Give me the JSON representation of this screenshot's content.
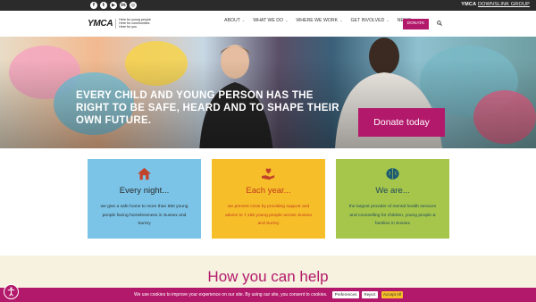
{
  "topbar": {
    "social": [
      "f",
      "t",
      "▶",
      "in",
      "◎"
    ],
    "group_link_bold": "YMCA",
    "group_link_rest": "DOWNSLINK GROUP"
  },
  "header": {
    "logo_word": "YMCA",
    "logo_tag": [
      "Here for young people",
      "Here for communities",
      "Here for you"
    ],
    "nav": [
      "ABOUT",
      "WHAT WE DO",
      "WHERE WE WORK",
      "GET INVOLVED",
      "NEWS"
    ],
    "donate": "DONATE"
  },
  "hero": {
    "headline": "EVERY CHILD AND YOUNG PERSON HAS THE RIGHT TO BE SAFE, HEARD AND TO SHAPE THEIR OWN FUTURE.",
    "button": "Donate today"
  },
  "cards": [
    {
      "title": "Every night...",
      "body": "we give a safe home to more than 650 young people facing homelessness in Sussex and Surrey",
      "icon": "house-icon",
      "color": "#7bc4e8"
    },
    {
      "title": "Each year...",
      "body": "we prevent crisis by providing support and advice to 7,156 young people across Sussex and Surrey",
      "icon": "hand-heart-icon",
      "color": "#f6bf2a"
    },
    {
      "title": "We are...",
      "body": "the largest provider of mental health services and counselling for children, young people & families in Sussex",
      "icon": "brain-icon",
      "color": "#a5c64b"
    }
  ],
  "help": {
    "title": "How you can help"
  },
  "cookie": {
    "text": "We use cookies to improve your experience on our site. By using our site, you consent to cookies.",
    "preferences": "Preferences",
    "reject": "Reject",
    "accept": "Accept All"
  },
  "colors": {
    "brand": "#b3196b",
    "yellow": "#f6bf2a",
    "blue": "#7bc4e8",
    "green": "#a5c64b"
  }
}
